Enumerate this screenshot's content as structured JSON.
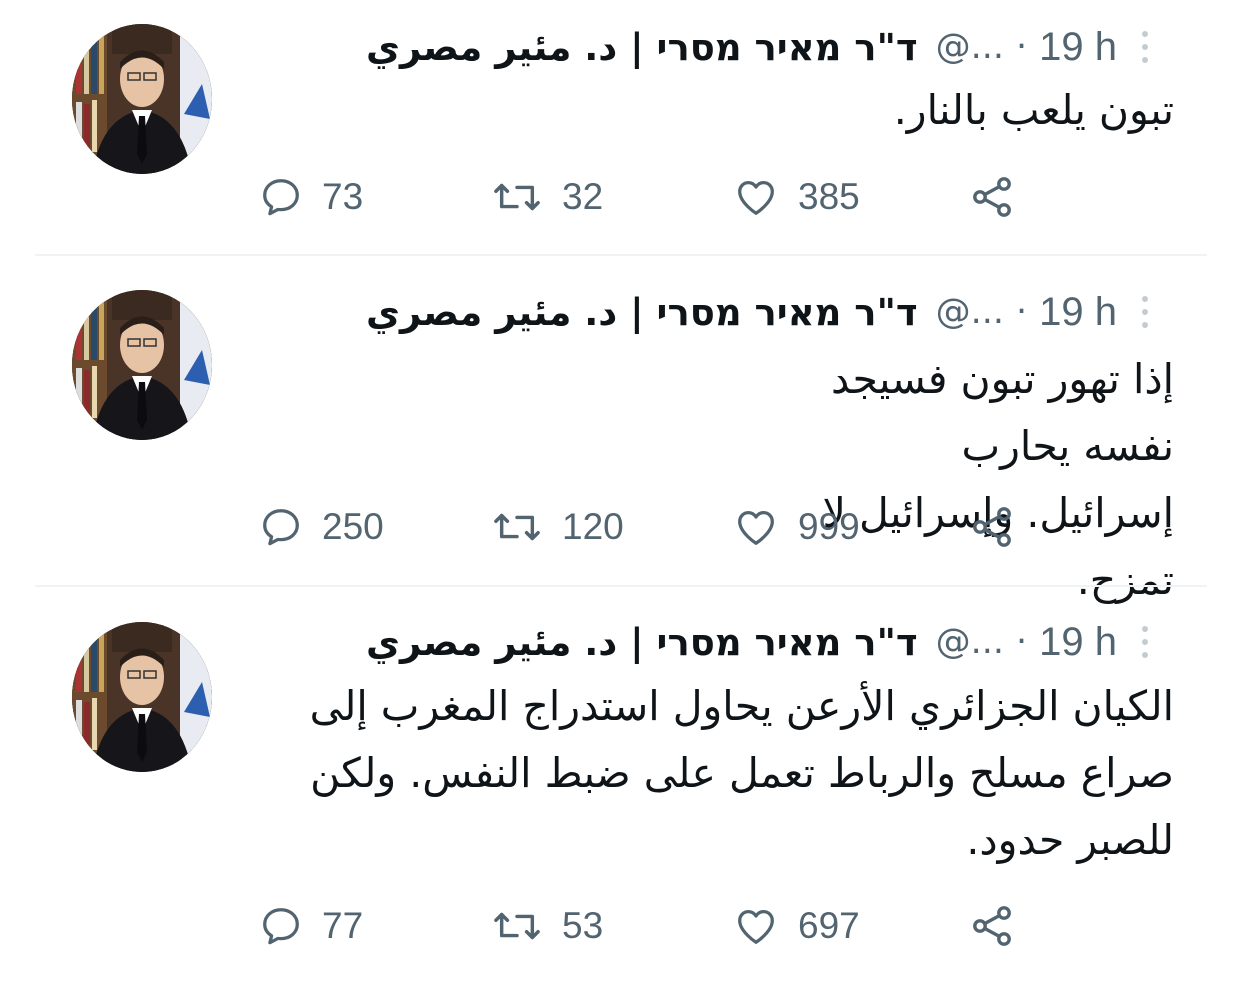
{
  "tweets": [
    {
      "name": "ד\"ר מאיר מסרי | د. مئير مصري",
      "handle": "@...",
      "separator": "·",
      "time": "19 h",
      "text": "تبون يلعب بالنار.",
      "replies": "73",
      "retweets": "32",
      "likes": "385"
    },
    {
      "name": "ד\"ר מאיר מסרי | د. مئير مصري",
      "handle": "@...",
      "separator": "·",
      "time": "19 h",
      "text": "إذا تهور تبون فسيجد نفسه يحارب إسرائيل. وإسرائيل لا تمزح.",
      "replies": "250",
      "retweets": "120",
      "likes": "999"
    },
    {
      "name": "ד\"ר מאיר מסרי | د. مئير مصري",
      "handle": "@...",
      "separator": "·",
      "time": "19 h",
      "text": "الكيان الجزائري الأرعن يحاول استدراج المغرب إلى صراع مسلح والرباط تعمل على ضبط النفس. ولكن للصبر حدود.",
      "replies": "77",
      "retweets": "53",
      "likes": "697"
    }
  ],
  "icons": {
    "reply": "reply-icon",
    "retweet": "retweet-icon",
    "like": "heart-icon",
    "share": "share-icon",
    "more": "more-vertical-icon"
  },
  "colors": {
    "text": "#0f1419",
    "muted": "#536471",
    "divider": "#eff3f4"
  }
}
